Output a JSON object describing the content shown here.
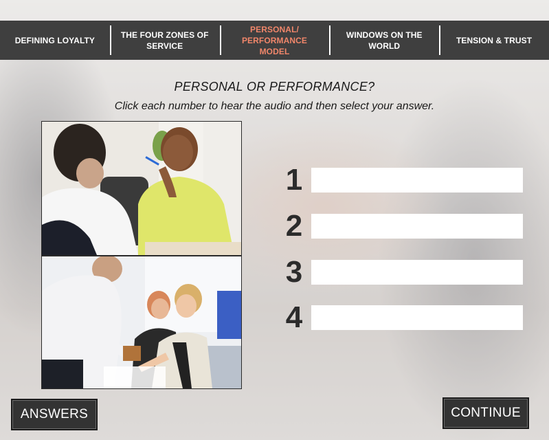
{
  "nav": {
    "items": [
      {
        "label": "DEFINING LOYALTY"
      },
      {
        "label": "THE FOUR ZONES OF SERVICE"
      },
      {
        "label": "PERSONAL/ PERFORMANCE MODEL"
      },
      {
        "label": "WINDOWS ON THE WORLD"
      },
      {
        "label": "TENSION & TRUST"
      }
    ],
    "active_index": 2,
    "active_color": "#f0866a",
    "background": "#3f3f3f"
  },
  "heading": {
    "title": "PERSONAL OR PERFORMANCE?",
    "instructions": "Click each number to hear the audio and then select your answer."
  },
  "photos": [
    {
      "name": "photo-job-interview"
    },
    {
      "name": "photo-handshake-meeting"
    }
  ],
  "answers": [
    {
      "number": "1",
      "value": ""
    },
    {
      "number": "2",
      "value": ""
    },
    {
      "number": "3",
      "value": ""
    },
    {
      "number": "4",
      "value": ""
    }
  ],
  "buttons": {
    "answers_label": "ANSWERS",
    "continue_label": "CONTINUE"
  }
}
